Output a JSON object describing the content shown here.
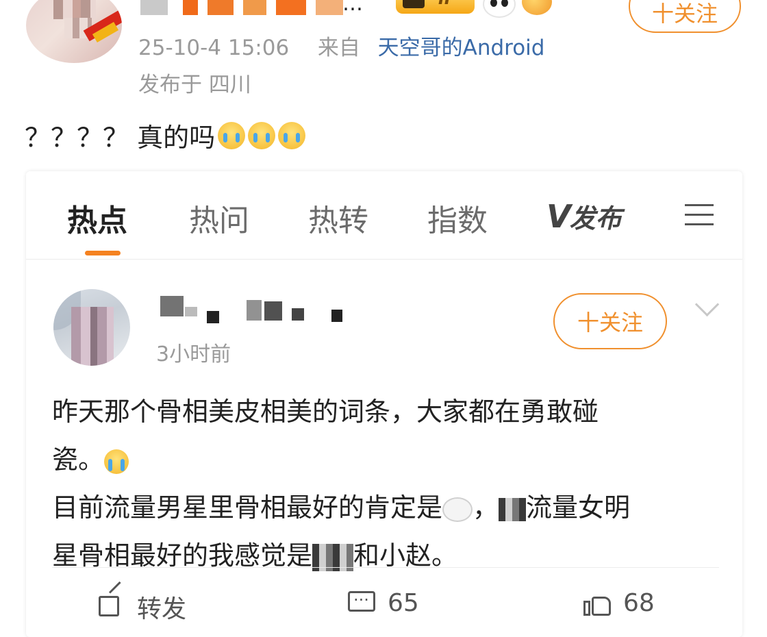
{
  "top_post": {
    "ellipsis": "…",
    "badge_level": "II",
    "follow_label": "十关注",
    "meta_time": "25-10-4 15:06",
    "meta_from": "来自",
    "meta_source": "天空哥的Android",
    "location": "发布于 四川",
    "text": "？？？？ 真的吗"
  },
  "card": {
    "tabs": [
      "热点",
      "热问",
      "热转",
      "指数"
    ],
    "publish_label": "发布",
    "publish_logo": "V",
    "author": {
      "follow_label": "十关注",
      "time": "3小时前"
    },
    "body": {
      "line1": "昨天那个骨相美皮相美的词条，大家都在勇敢碰",
      "line2": "瓷。",
      "line3a": "目前流量男星里骨相最好的肯定是",
      "line3b": "，",
      "line3c": "流量女明",
      "line4a": "星骨相最好的我感觉是",
      "line4b": "和小赵。"
    },
    "actions": {
      "repost_label": "转发",
      "comment_count": "65",
      "like_count": "68"
    },
    "accent_color": "#f0902e",
    "link_color": "#3b6ba8"
  }
}
